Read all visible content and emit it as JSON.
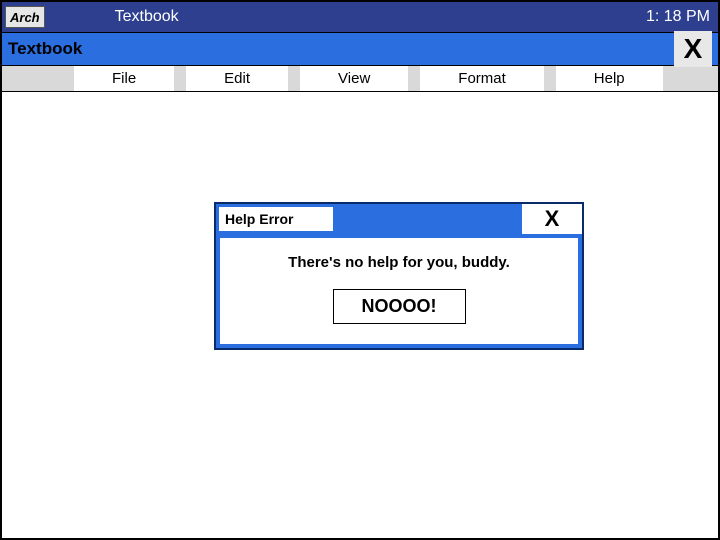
{
  "titlebar": {
    "logo": "Arch",
    "title": "Textbook",
    "clock": "1: 18 PM"
  },
  "subheader": {
    "title": "Textbook",
    "close": "X"
  },
  "menu": {
    "file": "File",
    "edit": "Edit",
    "view": "View",
    "format": "Format",
    "help": "Help"
  },
  "dialog": {
    "title": "Help Error",
    "close": "X",
    "message": "There's no help for you, buddy.",
    "button": "NOOOO!"
  }
}
